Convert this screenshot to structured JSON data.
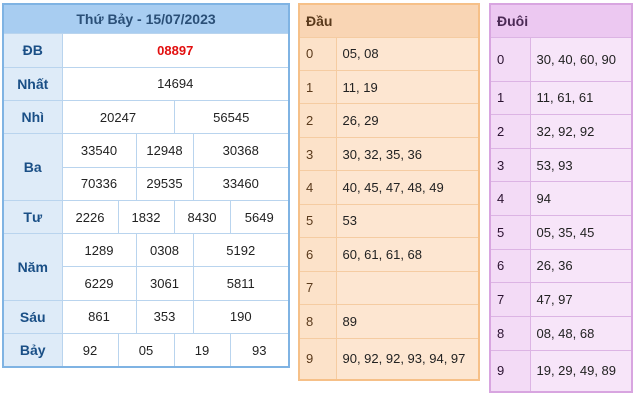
{
  "results": {
    "title": "Thứ Bảy - 15/07/2023",
    "rows": [
      {
        "label": "ĐB",
        "values": [
          "08897"
        ]
      },
      {
        "label": "Nhất",
        "values": [
          "14694"
        ]
      },
      {
        "label": "Nhì",
        "values": [
          "20247",
          "56545"
        ]
      },
      {
        "label": "Ba",
        "values": [
          "33540",
          "12948",
          "30368",
          "70336",
          "29535",
          "33460"
        ]
      },
      {
        "label": "Tư",
        "values": [
          "2226",
          "1832",
          "8430",
          "5649"
        ]
      },
      {
        "label": "Năm",
        "values": [
          "1289",
          "0308",
          "5192",
          "6229",
          "3061",
          "5811"
        ]
      },
      {
        "label": "Sáu",
        "values": [
          "861",
          "353",
          "190"
        ]
      },
      {
        "label": "Bảy",
        "values": [
          "92",
          "05",
          "19",
          "93"
        ]
      }
    ],
    "special_color": "#e20f0f"
  },
  "dau": {
    "title": "Đầu",
    "rows": [
      {
        "key": "0",
        "value": "05, 08"
      },
      {
        "key": "1",
        "value": "11, 19"
      },
      {
        "key": "2",
        "value": "26, 29"
      },
      {
        "key": "3",
        "value": "30, 32, 35, 36"
      },
      {
        "key": "4",
        "value": "40, 45, 47, 48, 49"
      },
      {
        "key": "5",
        "value": "53"
      },
      {
        "key": "6",
        "value": "60, 61, 61, 68"
      },
      {
        "key": "7",
        "value": ""
      },
      {
        "key": "8",
        "value": "89"
      },
      {
        "key": "9",
        "value": "90, 92, 92, 93, 94, 97"
      }
    ]
  },
  "duoi": {
    "title": "Đuôi",
    "rows": [
      {
        "key": "0",
        "value": "30, 40, 60, 90"
      },
      {
        "key": "1",
        "value": "11, 61, 61"
      },
      {
        "key": "2",
        "value": "32, 92, 92"
      },
      {
        "key": "3",
        "value": "53, 93"
      },
      {
        "key": "4",
        "value": "94"
      },
      {
        "key": "5",
        "value": "05, 35, 45"
      },
      {
        "key": "6",
        "value": "26, 36"
      },
      {
        "key": "7",
        "value": "47, 97"
      },
      {
        "key": "8",
        "value": "08, 48, 68"
      },
      {
        "key": "9",
        "value": "19, 29, 49, 89"
      }
    ]
  }
}
